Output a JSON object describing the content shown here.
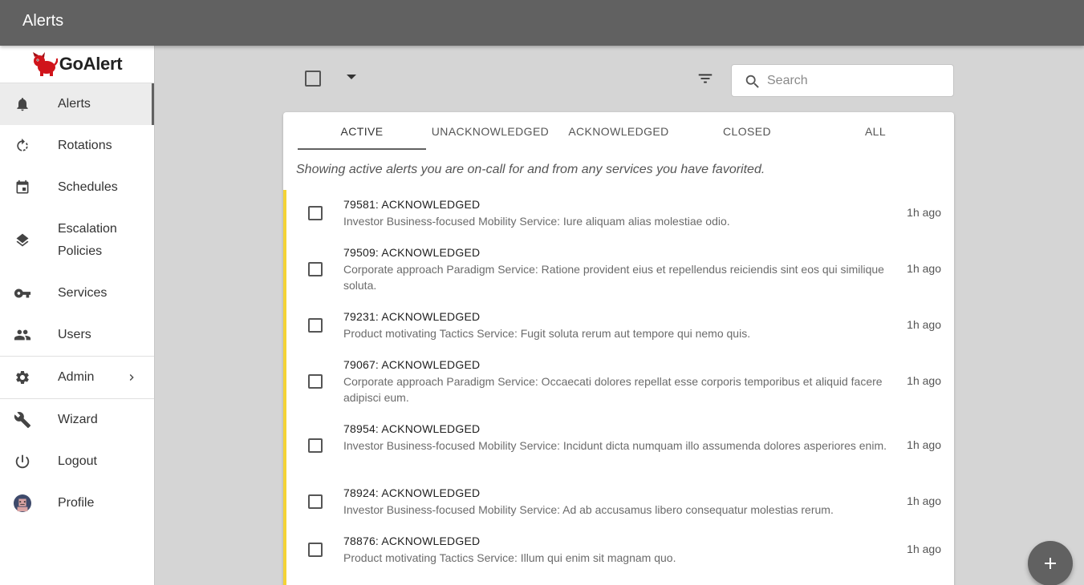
{
  "appbar": {
    "title": "Alerts"
  },
  "brand": {
    "name": "GoAlert",
    "logo_icon": "red-dog-mascot-icon"
  },
  "sidebar": {
    "items": [
      {
        "label": "Alerts",
        "icon": "bell-icon",
        "active": true
      },
      {
        "label": "Rotations",
        "icon": "rotate-icon"
      },
      {
        "label": "Schedules",
        "icon": "calendar-icon"
      },
      {
        "label": "Escalation Policies",
        "icon": "layers-icon"
      },
      {
        "label": "Services",
        "icon": "key-icon"
      },
      {
        "label": "Users",
        "icon": "people-icon"
      },
      {
        "label": "Admin",
        "icon": "gear-icon"
      },
      {
        "label": "Wizard",
        "icon": "wrench-icon"
      },
      {
        "label": "Logout",
        "icon": "power-icon"
      },
      {
        "label": "Profile",
        "icon": "avatar-icon"
      }
    ]
  },
  "toolbar": {
    "search_placeholder": "Search",
    "filter_icon": "filter-icon",
    "select_menu_icon": "caret-down-icon"
  },
  "tabs": [
    {
      "label": "ACTIVE",
      "active": true
    },
    {
      "label": "UNACKNOWLEDGED"
    },
    {
      "label": "ACKNOWLEDGED"
    },
    {
      "label": "CLOSED"
    },
    {
      "label": "ALL"
    }
  ],
  "info_text": "Showing active alerts you are on-call for and from any services you have favorited.",
  "accent_color": "#f4d336",
  "alerts": [
    {
      "title": "79581: ACKNOWLEDGED",
      "description": "Investor Business-focused Mobility Service: Iure aliquam alias molestiae odio.",
      "time": "1h ago"
    },
    {
      "title": "79509: ACKNOWLEDGED",
      "description": "Corporate approach Paradigm Service: Ratione provident eius et repellendus reiciendis sint eos qui similique soluta.",
      "time": "1h ago"
    },
    {
      "title": "79231: ACKNOWLEDGED",
      "description": "Product motivating Tactics Service: Fugit soluta rerum aut tempore qui nemo quis.",
      "time": "1h ago"
    },
    {
      "title": "79067: ACKNOWLEDGED",
      "description": "Corporate approach Paradigm Service: Occaecati dolores repellat esse corporis temporibus et aliquid facere adipisci eum.",
      "time": "1h ago"
    },
    {
      "title": "78954: ACKNOWLEDGED",
      "description": "Investor Business-focused Mobility Service: Incidunt dicta numquam illo assumenda dolores asperiores enim.",
      "time": "1h ago"
    },
    {
      "title": "78924: ACKNOWLEDGED",
      "description": "Investor Business-focused Mobility Service: Ad ab accusamus libero consequatur molestias rerum.",
      "time": "1h ago"
    },
    {
      "title": "78876: ACKNOWLEDGED",
      "description": "Product motivating Tactics Service: Illum qui enim sit magnam quo.",
      "time": "1h ago"
    }
  ],
  "fab": {
    "icon": "plus-icon"
  }
}
